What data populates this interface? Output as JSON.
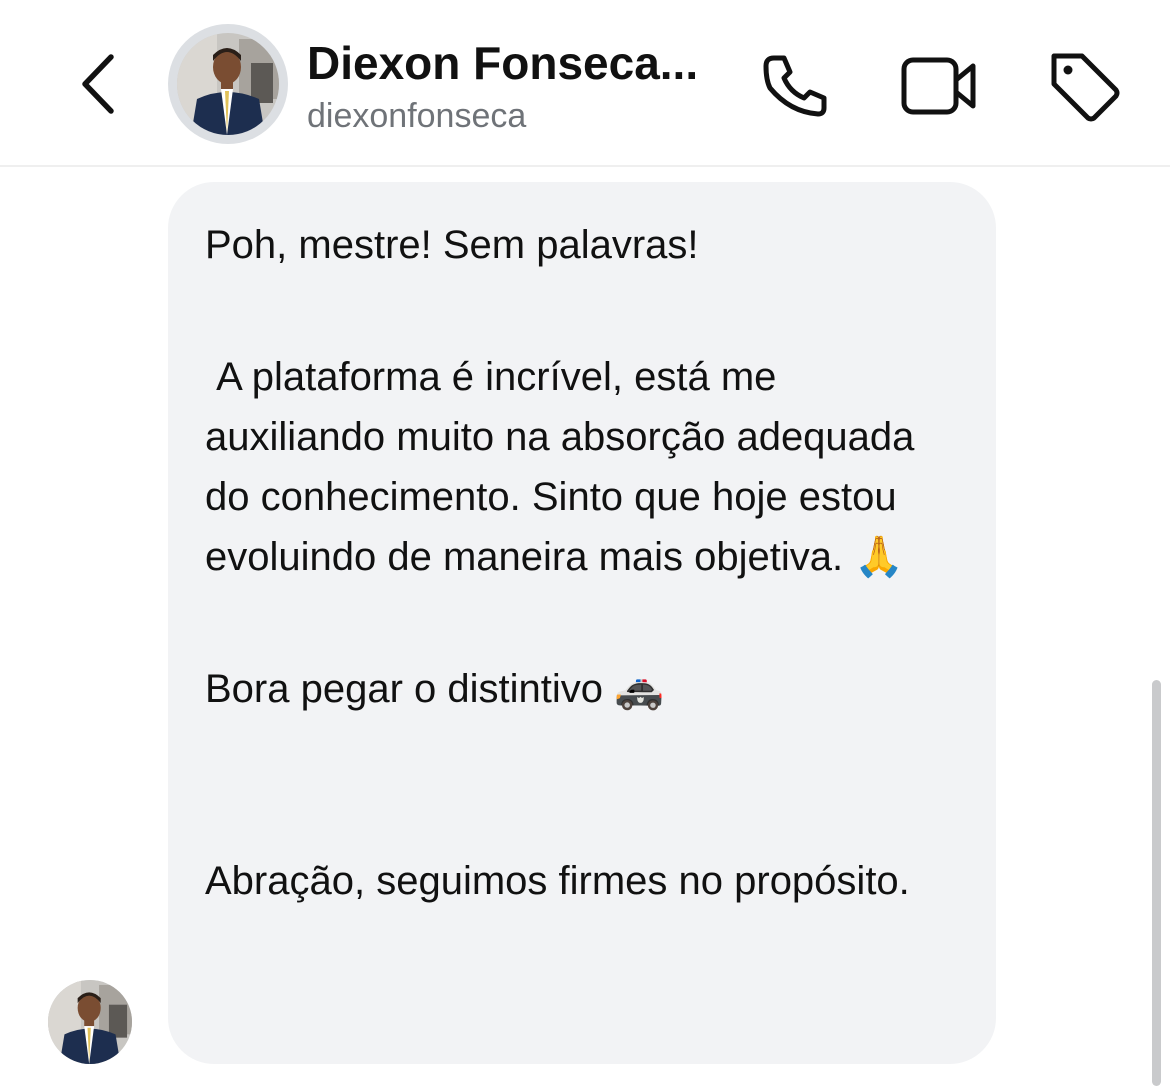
{
  "header": {
    "back_icon": "chevron-left-icon",
    "contact_name": "Diexon Fonseca...",
    "username": "diexonfonseca",
    "avatar": "profile-photo",
    "actions": {
      "call_icon": "phone-icon",
      "video_icon": "video-camera-icon",
      "tag_icon": "tag-icon"
    }
  },
  "message": {
    "paragraph_1": "Poh, mestre! Sem palavras!",
    "paragraph_2": " A plataforma é incrível, está me auxiliando muito na absorção adequada do conhecimento. Sinto que hoje estou evoluindo de maneira mais objetiva. 🙏",
    "paragraph_3": "Bora pegar o distintivo 🚓",
    "paragraph_4": "Abração, seguimos firmes no propósito."
  },
  "colors": {
    "bubble": "#f2f3f5",
    "text": "#111111",
    "secondary_text": "#6f7378",
    "divider": "#efefef"
  }
}
